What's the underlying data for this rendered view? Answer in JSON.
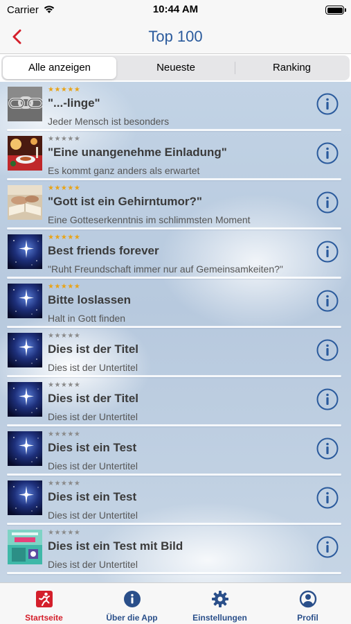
{
  "status_bar": {
    "carrier": "Carrier",
    "time": "10:44 AM"
  },
  "nav": {
    "title": "Top 100"
  },
  "segments": [
    {
      "label": "Alle anzeigen",
      "selected": true
    },
    {
      "label": "Neueste",
      "selected": false
    },
    {
      "label": "Ranking",
      "selected": false
    }
  ],
  "items": [
    {
      "stars": "★★★★★",
      "rated": true,
      "title": "\"...-linge\"",
      "subtitle": "Jeder Mensch ist besonders",
      "thumb": "chain"
    },
    {
      "stars": "★★★★★",
      "rated": false,
      "title": "\"Eine unangenehme Einladung\"",
      "subtitle": "Es kommt ganz anders als erwartet",
      "thumb": "dinner"
    },
    {
      "stars": "★★★★★",
      "rated": true,
      "title": "\"Gott ist ein Gehirntumor?\"",
      "subtitle": "Eine Gotteserkenntnis im schlimmsten Moment",
      "thumb": "book"
    },
    {
      "stars": "★★★★★",
      "rated": true,
      "title": "Best friends forever",
      "subtitle": "\"Ruht Freundschaft immer nur auf Gemeinsamkeiten?\"",
      "thumb": "space"
    },
    {
      "stars": "★★★★★",
      "rated": true,
      "title": "Bitte loslassen",
      "subtitle": "Halt in Gott finden",
      "thumb": "space"
    },
    {
      "stars": "★★★★★",
      "rated": false,
      "title": "Dies ist der Titel",
      "subtitle": "Dies ist der Untertitel",
      "thumb": "space"
    },
    {
      "stars": "★★★★★",
      "rated": false,
      "title": "Dies ist der Titel",
      "subtitle": "Dies ist der Untertitel",
      "thumb": "space"
    },
    {
      "stars": "★★★★★",
      "rated": false,
      "title": "Dies ist ein Test",
      "subtitle": "Dies ist der Untertitel",
      "thumb": "space"
    },
    {
      "stars": "★★★★★",
      "rated": false,
      "title": "Dies ist ein Test",
      "subtitle": "Dies ist der Untertitel",
      "thumb": "space"
    },
    {
      "stars": "★★★★★",
      "rated": false,
      "title": "Dies ist ein Test mit Bild",
      "subtitle": "Dies ist der Untertitel",
      "thumb": "ad"
    }
  ],
  "tabs": [
    {
      "label": "Startseite",
      "icon": "home-runner-icon",
      "active": true
    },
    {
      "label": "Über die App",
      "icon": "info-icon",
      "active": false
    },
    {
      "label": "Einstellungen",
      "icon": "gear-icon",
      "active": false
    },
    {
      "label": "Profil",
      "icon": "person-icon",
      "active": false
    }
  ],
  "colors": {
    "accent_blue": "#2a5a9c",
    "accent_red": "#d41f2b",
    "star_gold": "#e8a317",
    "star_gray": "#8a8a8a"
  }
}
